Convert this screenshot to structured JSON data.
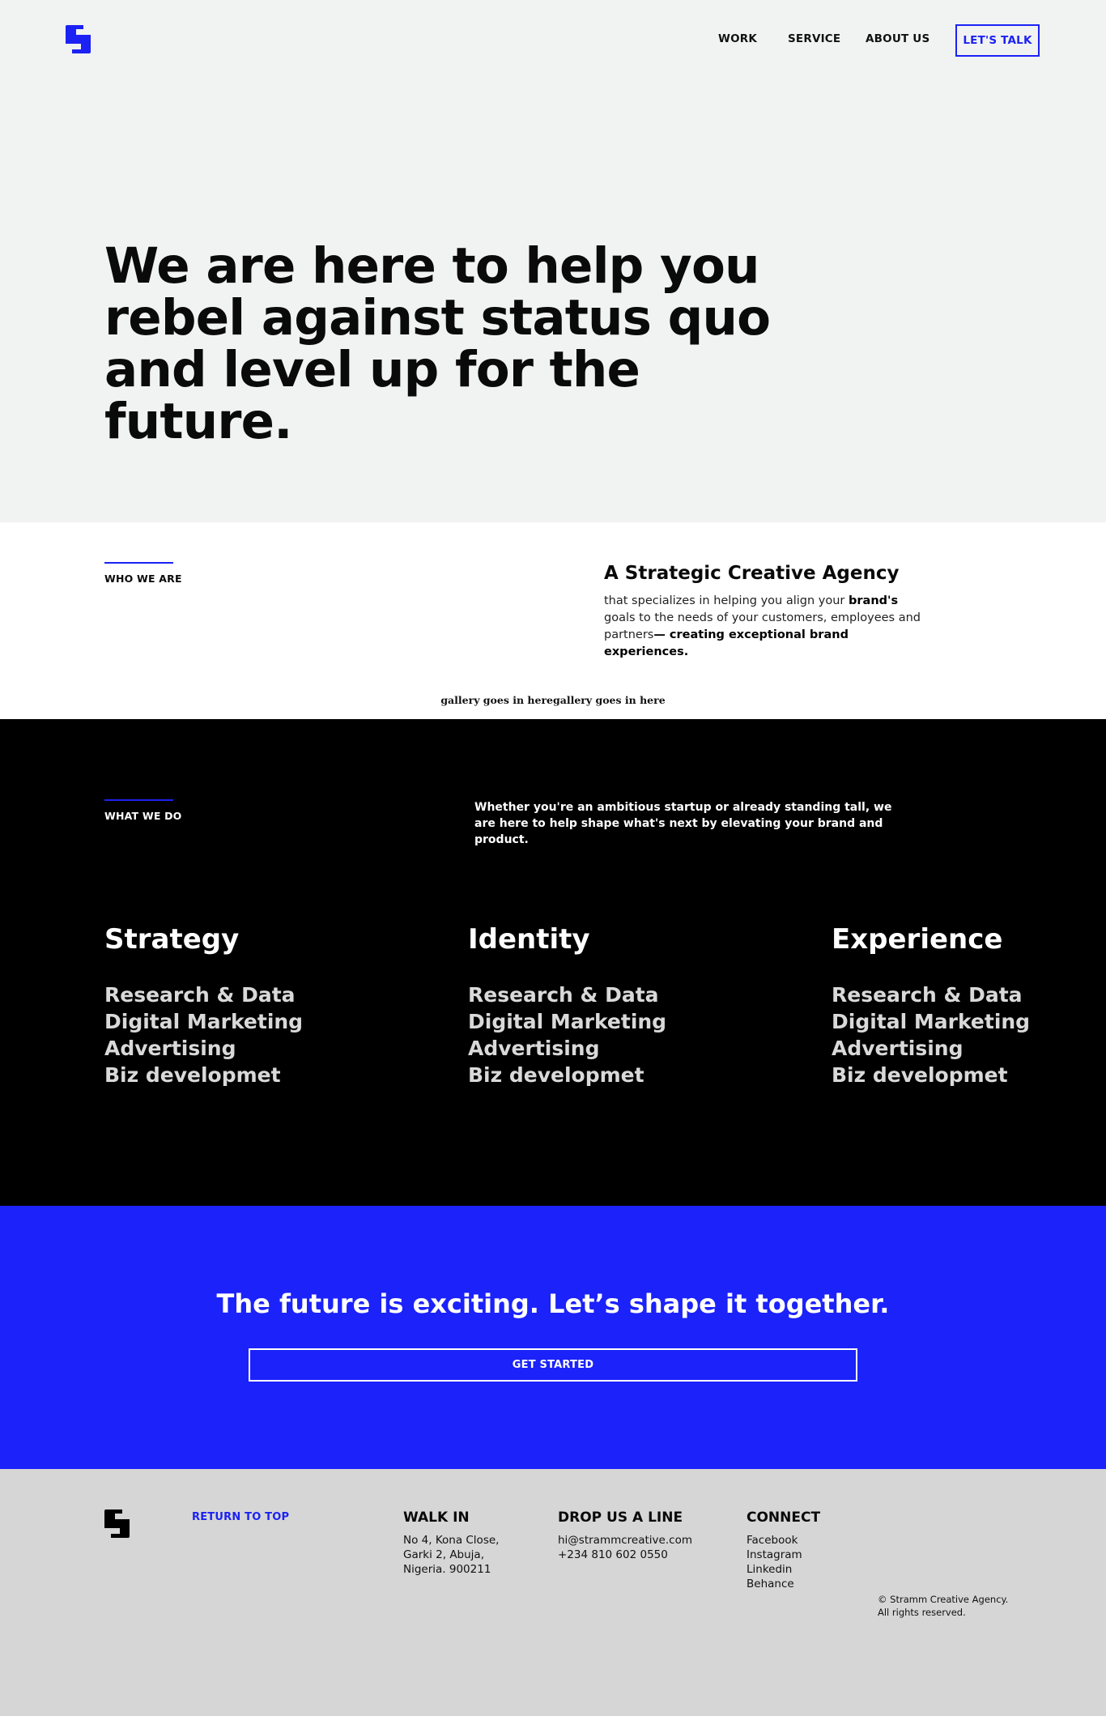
{
  "header": {
    "nav": [
      "WORK",
      "SERVICE",
      "ABOUT US"
    ],
    "cta_label": "LET'S TALK"
  },
  "hero": {
    "lines": [
      "We are here to help you",
      "rebel against status quo",
      "and level up for the future."
    ]
  },
  "who_we_are": {
    "label": "WHO WE ARE",
    "title": "A Strategic Creative Agency",
    "body_part1": "that specializes in helping you align your ",
    "body_bold1": "brand's",
    "body_part2": " goals to the needs of your customers, employees and partners",
    "body_bold2": "— creating exceptional brand experiences."
  },
  "gallery_placeholder": "gallery goes in heregallery goes in here",
  "what_we_do": {
    "label": "WHAT WE DO",
    "intro": "Whether you're an ambitious startup or already standing tall, we are here to help shape what's next by elevating your brand and product.",
    "columns": [
      {
        "title": "Strategy",
        "items": [
          "Research & Data",
          "Digital Marketing",
          "Advertising",
          "Biz developmet"
        ]
      },
      {
        "title": "Identity",
        "items": [
          "Research & Data",
          "Digital Marketing",
          "Advertising",
          "Biz developmet"
        ]
      },
      {
        "title": "Experience",
        "items": [
          "Research & Data",
          "Digital Marketing",
          "Advertising",
          "Biz developmet"
        ]
      }
    ]
  },
  "cta": {
    "title": "The future is exciting. Let’s shape it together.",
    "button": "GET STARTED"
  },
  "footer": {
    "return_top": "RETURN TO TOP",
    "walk_in": {
      "heading": "WALK IN",
      "lines": [
        "No 4, Kona Close,",
        "Garki 2, Abuja,",
        "Nigeria. 900211"
      ]
    },
    "drop_line": {
      "heading": "DROP US A LINE",
      "lines": [
        "hi@strammcreative.com",
        "+234 810 602 0550"
      ]
    },
    "connect": {
      "heading": "CONNECT",
      "links": [
        "Facebook",
        "Instagram",
        "Linkedin",
        "Behance"
      ]
    },
    "copyright": [
      "© Stramm Creative Agency.",
      "All rights reserved."
    ]
  },
  "colors": {
    "accent": "#1b22f3",
    "cta_bg": "#1b22fa",
    "page_bg": "#f1f2f2",
    "footer_bg": "#d6d6d6",
    "dark_bg": "#000000"
  },
  "icons": {
    "logo": "stramm-s-logo-icon"
  }
}
